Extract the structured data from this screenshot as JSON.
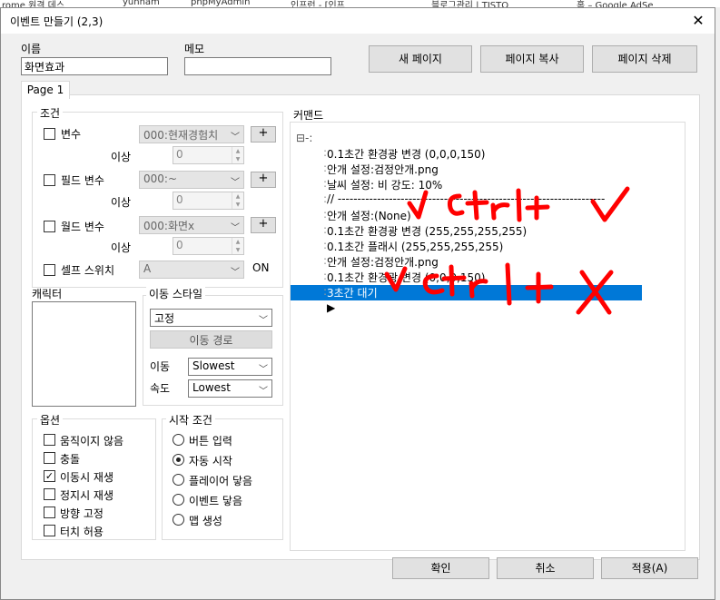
{
  "taskbar": [
    "rome 원격 데스",
    "yunham",
    "phpMyAdmin",
    "인프런 - [인프",
    "블로그관리 | TISTO",
    "홈 – Google AdSe"
  ],
  "window": {
    "title": "이벤트 만들기 (2,3)"
  },
  "name_label": "이름",
  "name_value": "화면효과",
  "memo_label": "메모",
  "memo_value": "",
  "buttons": {
    "new_page": "새 페이지",
    "copy_page": "페이지 복사",
    "delete_page": "페이지 삭제"
  },
  "tab": "Page 1",
  "conditions": {
    "title": "조건",
    "variable_label": "변수",
    "variable_select": "000:현재경험치",
    "variable_min_label": "이상",
    "variable_min": "0",
    "field_variable_label": "필드 변수",
    "field_variable_select": "000:~",
    "field_min_label": "이상",
    "field_min": "0",
    "world_variable_label": "월드 변수",
    "world_variable_select": "000:화면x",
    "world_min_label": "이상",
    "world_min": "0",
    "self_switch_label": "셀프 스위치",
    "self_switch_select": "A",
    "self_switch_state": "ON",
    "plus": "+"
  },
  "character": {
    "title": "캐릭터"
  },
  "movement": {
    "title": "이동 스타일",
    "type": "고정",
    "route_button": "이동 경로",
    "speed_label_1": "이동",
    "speed_label_2": "속도",
    "speed_value": "Slowest",
    "frequency_value": "Lowest"
  },
  "options": {
    "title": "옵션",
    "items": [
      {
        "label": "움직이지 않음",
        "mark": ""
      },
      {
        "label": "충돌",
        "mark": ""
      },
      {
        "label": "이동시 재생",
        "mark": "✓"
      },
      {
        "label": "정지시 재생",
        "mark": ""
      },
      {
        "label": "방향 고정",
        "mark": ""
      },
      {
        "label": "터치 허용",
        "mark": ""
      }
    ]
  },
  "trigger": {
    "title": "시작 조건",
    "items": [
      {
        "label": "버튼 입력",
        "selected": false
      },
      {
        "label": "자동 시작",
        "selected": true
      },
      {
        "label": "플레이어 닿음",
        "selected": false
      },
      {
        "label": "이벤트 닿음",
        "selected": false
      },
      {
        "label": "맵 생성",
        "selected": false
      }
    ]
  },
  "commands": {
    "title": "커맨드",
    "tree_root": "⊟-:",
    "items": [
      "0.1초간 환경광 변경 (0,0,0,150)",
      "안개 설정:검정안개.png",
      "날씨 설정: 비 강도: 10%",
      "// --------------------------------------------------------------------",
      "안개 설정:(None)",
      "0.1초간 환경광 변경 (255,255,255,255)",
      "0.1초간 플래시 (255,255,255,255)",
      "안개 설정:검정안개.png",
      "0.1초간 환경광 변경 (0,0,0,150)",
      "3초간 대기"
    ],
    "selected_index": 9,
    "end_marker": "▶"
  },
  "footer": {
    "ok": "확인",
    "cancel": "취소",
    "apply": "적용(A)"
  },
  "colors": {
    "selection": "#0078d7",
    "annotation": "#ff0000"
  }
}
